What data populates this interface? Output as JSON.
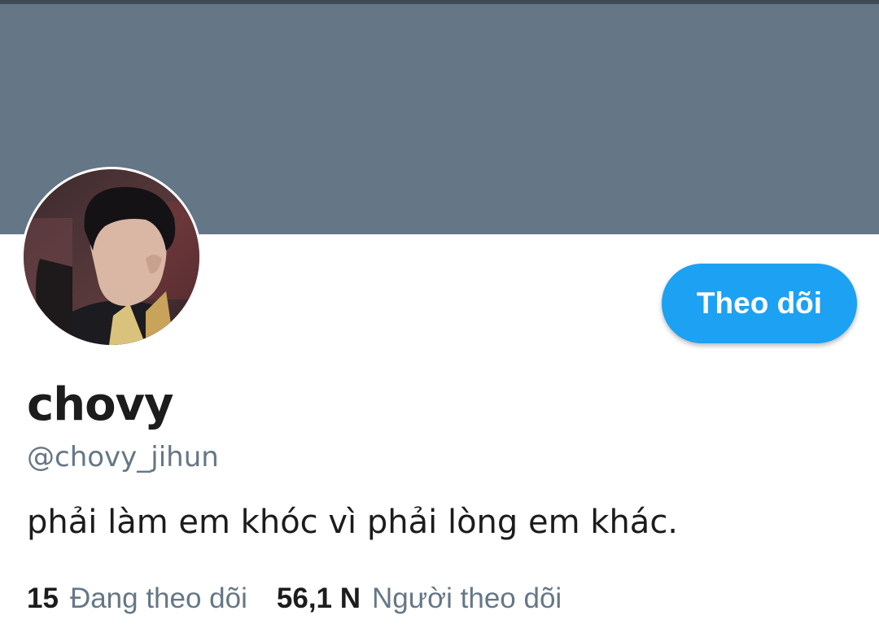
{
  "profile": {
    "display_name": "chovy",
    "handle": "@chovy_jihun",
    "bio": "phải làm em khóc vì phải lòng em khác.",
    "follow_button_label": "Theo dõi"
  },
  "stats": {
    "following_count": "15",
    "following_label": "Đang theo dõi",
    "followers_count": "56,1 N",
    "followers_label": "Người theo dõi"
  },
  "colors": {
    "banner": "#657786",
    "accent": "#1da1f2",
    "secondary_text": "#657786",
    "primary_text": "#1c1c1c"
  },
  "icons": {
    "avatar": "profile-photo"
  }
}
